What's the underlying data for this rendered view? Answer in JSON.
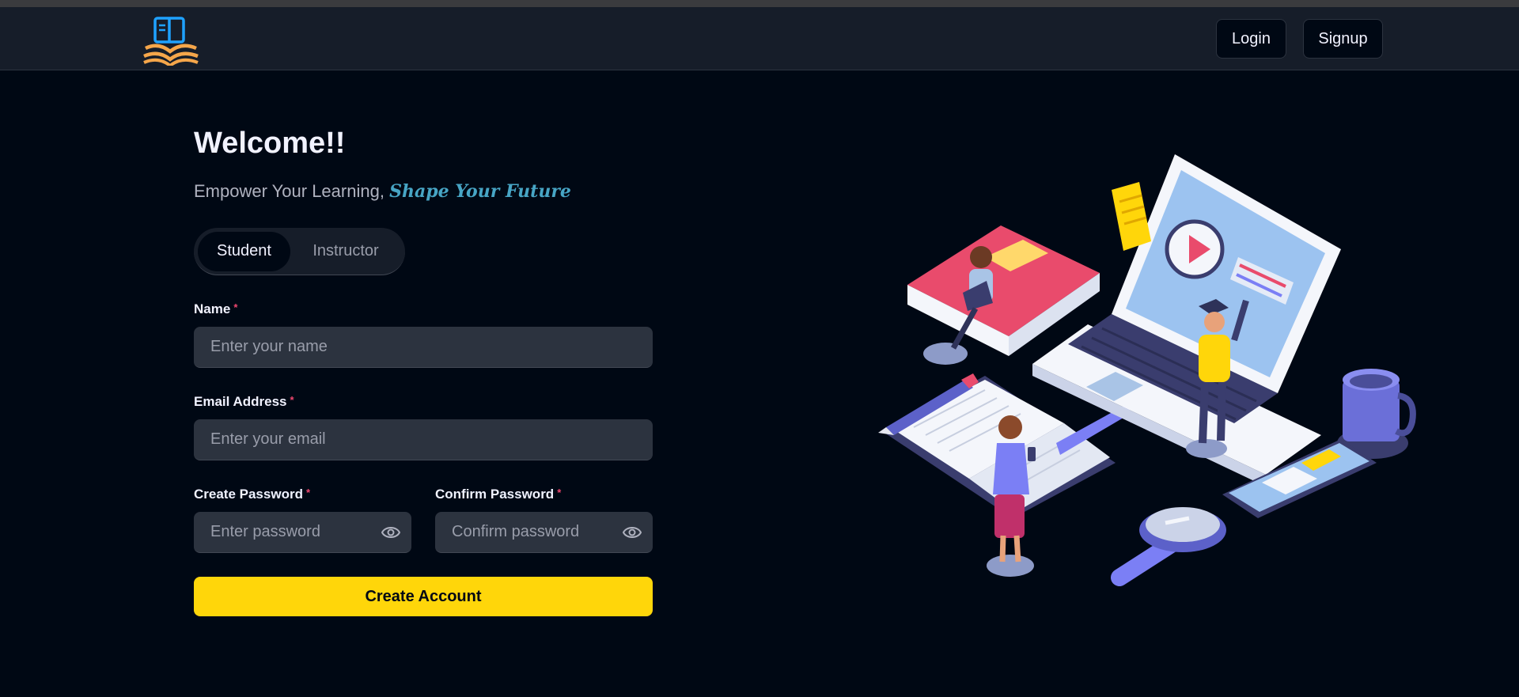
{
  "navbar": {
    "logo_icon": "open-book-logo-icon",
    "login_label": "Login",
    "signup_label": "Signup"
  },
  "hero": {
    "title": "Welcome!!",
    "subtitle_plain": "Empower Your Learning,",
    "subtitle_highlight": "Shape Your Future"
  },
  "role_tabs": [
    {
      "label": "Student",
      "active": true
    },
    {
      "label": "Instructor",
      "active": false
    }
  ],
  "form": {
    "name": {
      "label": "Name",
      "required": "*",
      "placeholder": "Enter your name",
      "value": ""
    },
    "email": {
      "label": "Email Address",
      "required": "*",
      "placeholder": "Enter your email",
      "value": ""
    },
    "create_password": {
      "label": "Create Password",
      "required": "*",
      "placeholder": "Enter password",
      "value": "",
      "icon": "eye-icon"
    },
    "confirm_password": {
      "label": "Confirm Password",
      "required": "*",
      "placeholder": "Confirm password",
      "value": "",
      "icon": "eye-icon"
    },
    "submit_label": "Create Account"
  },
  "illustration": {
    "icon": "online-learning-illustration"
  },
  "colors": {
    "background": "#000814",
    "navbar": "#161D29",
    "input": "#2C333F",
    "accent_yellow": "#FFD60A",
    "highlight_blue": "#47A5C5",
    "required_pink": "#EF476F"
  }
}
